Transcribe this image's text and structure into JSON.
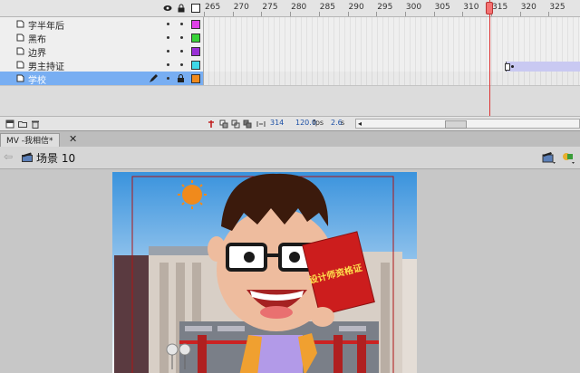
{
  "timeline": {
    "frame_ticks": [
      "265",
      "270",
      "275",
      "280",
      "285",
      "290",
      "295",
      "300",
      "305",
      "310",
      "315",
      "320",
      "325"
    ],
    "header_icons": [
      "eye-icon",
      "lock-icon",
      "outline-icon"
    ],
    "layers": [
      {
        "name": "字半年后",
        "color": "#e040e8",
        "selected": false
      },
      {
        "name": "黑布",
        "color": "#37d337",
        "selected": false
      },
      {
        "name": "边界",
        "color": "#9a2fd6",
        "selected": false
      },
      {
        "name": "男主持证",
        "color": "#3ed8e8",
        "selected": false
      },
      {
        "name": "学校",
        "color": "#f08a1c",
        "selected": true
      }
    ],
    "current_frame": "314",
    "fps": "120.0",
    "fps_unit": "fps",
    "time": "2.6",
    "time_unit": "s"
  },
  "document": {
    "tab_label": "MV -我相信*",
    "close_glyph": "✕"
  },
  "editbar": {
    "scene_label": "场景 10",
    "back_glyph": "⇦"
  },
  "stage": {
    "certificate_text": "设计师资格证",
    "colors": {
      "sky_top": "#3a93dd",
      "sky_bottom": "#ffffff",
      "sun": "#f08a1c",
      "certificate": "#cc1d1d",
      "hair": "#3b1a0c",
      "shirt": "#b29ae8",
      "skin": "#eebc9e"
    }
  }
}
